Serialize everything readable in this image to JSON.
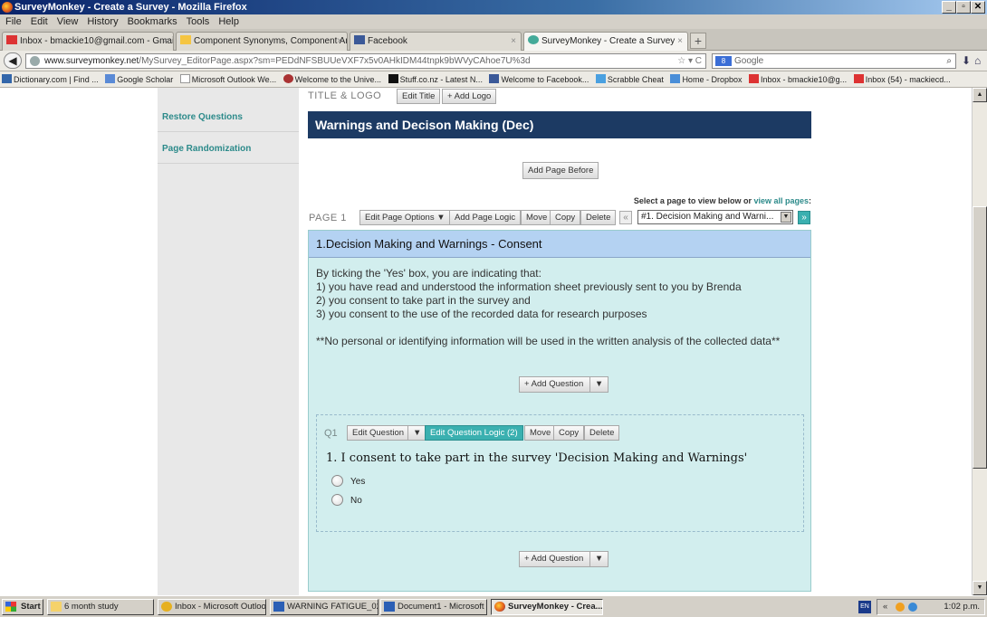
{
  "window": {
    "title": "SurveyMonkey - Create a Survey - Mozilla Firefox",
    "controls": [
      "_",
      "▫",
      "✕"
    ]
  },
  "menu": [
    "File",
    "Edit",
    "View",
    "History",
    "Bookmarks",
    "Tools",
    "Help"
  ],
  "tabs": [
    {
      "label": "Inbox - bmackie10@gmail.com - Gmail",
      "active": false
    },
    {
      "label": "Component Synonyms, Component Anto...",
      "active": false
    },
    {
      "label": "Facebook",
      "active": false
    },
    {
      "label": "SurveyMonkey - Create a Survey",
      "active": true
    }
  ],
  "nav": {
    "url_domain": "www.surveymonkey.net",
    "url_path": "/MySurvey_EditorPage.aspx?sm=PEDdNFSBUUeVXF7x5v0AHkIDM44tnpk9bWVyCAhoe7U%3d",
    "search_engine": "8",
    "search_placeholder": "Google"
  },
  "bookmarks": [
    "Dictionary.com | Find ...",
    "Google Scholar",
    "Microsoft Outlook We...",
    "Welcome to the Unive...",
    "Stuff.co.nz - Latest N...",
    "Welcome to Facebook...",
    "Scrabble Cheat",
    "Home - Dropbox",
    "Inbox - bmackie10@g...",
    "Inbox (54) - mackiecd..."
  ],
  "sidebar": {
    "items": [
      {
        "label": "Restore Questions"
      },
      {
        "label": "Page Randomization"
      }
    ]
  },
  "editor": {
    "title_logo_label": "TITLE & LOGO",
    "edit_title": "Edit Title",
    "add_logo": "+ Add Logo",
    "survey_title": "Warnings and Decison Making (Dec)",
    "add_page_before": "Add Page Before",
    "select_text": "Select a page to view below or",
    "view_all_pages": "view all pages",
    "select_colon": ":",
    "page_label": "PAGE 1",
    "page_buttons": {
      "edit_options": "Edit Page Options ▼",
      "add_logic": "Add Page Logic",
      "move": "Move",
      "copy": "Copy",
      "delete": "Delete"
    },
    "page_select_value": "#1. Decision Making and Warni...",
    "prev": "«",
    "next": "»"
  },
  "page": {
    "header": "1.Decision Making and Warnings - Consent",
    "intro": [
      "By ticking the 'Yes' box, you are indicating that:",
      "1) you have read and understood the information sheet previously sent to you by Brenda",
      "2) you consent to take part in the survey and",
      "3) you consent to the use of the recorded data for research purposes",
      "",
      "**No personal or identifying information will be used in the written analysis of the collected data**"
    ],
    "add_question": "+ Add Question",
    "add_question_arrow": "▼"
  },
  "question": {
    "label": "Q1",
    "edit_question": "Edit Question",
    "edit_arrow": "▼",
    "edit_logic": "Edit Question Logic (2)",
    "move": "Move",
    "copy": "Copy",
    "delete": "Delete",
    "text": "1. I consent to take part in the survey 'Decision Making and Warnings'",
    "options": [
      "Yes",
      "No"
    ]
  },
  "taskbar": {
    "start": "Start",
    "items": [
      {
        "label": "6 month study",
        "active": false
      },
      {
        "label": "Inbox - Microsoft Outlook",
        "active": false
      },
      {
        "label": "WARNING FATIGUE_02 -...",
        "active": false
      },
      {
        "label": "Document1 - Microsoft ...",
        "active": false
      },
      {
        "label": "SurveyMonkey - Crea...",
        "active": true
      }
    ],
    "lang": "EN",
    "time": "1:02 p.m."
  }
}
